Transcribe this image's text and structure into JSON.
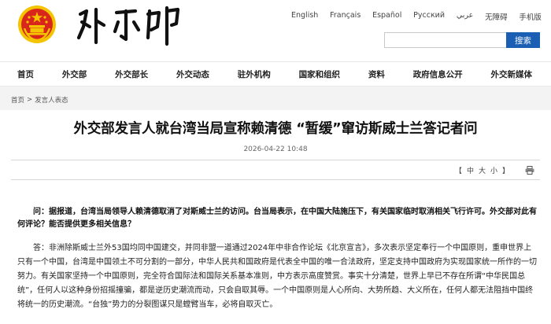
{
  "header": {
    "logo_alt": "国徽",
    "site_name": "外交部"
  },
  "languages": [
    "English",
    "Français",
    "Español",
    "Русский",
    "عربي",
    "无障碍",
    "手机版"
  ],
  "search": {
    "placeholder": "",
    "button_label": "搜索"
  },
  "nav": [
    "首页",
    "外交部",
    "外交部长",
    "外交动态",
    "驻外机构",
    "国家和组织",
    "资料",
    "政府信息公开",
    "外交新媒体"
  ],
  "breadcrumb": [
    "首页",
    "发言人表态"
  ],
  "breadcrumb_sep": ">",
  "article": {
    "title": "外交部发言人就台湾当局宣称赖清德 “暂缓”窜访斯威士兰答记者问",
    "date": "2026-04-22 10:48",
    "font_tools": {
      "open": "【",
      "large": "中",
      "medium": "大",
      "small": "小",
      "close": "】"
    },
    "print_label": "",
    "question": "问：据报道，台湾当局领导人赖清德取消了对斯威士兰的访问。台当局表示，在中国大陆施压下，有关国家临时取消相关飞行许可。外交部对此有何评论？能否提供更多相关信息？",
    "answer": "答：非洲除斯威士兰外53国均同中国建交，并同非盟一道通过2024年中非合作论坛《北京宣言》，多次表示坚定奉行一个中国原则，重申世界上只有一个中国，台湾是中国领土不可分割的一部分，中华人民共和国政府是代表全中国的唯一合法政府，坚定支持中国政府为实现国家统一所作的一切努力。有关国家坚持一个中国原则，完全符合国际法和国际关系基本准则，中方表示高度赞赏。事实十分清楚，世界上早已不存在所谓“中华民国总统”，任何人以这种身份招摇撞骗，都是逆历史潮流而动，只会自取其辱。一个中国原则是人心所向、大势所趋、大义所在，任何人都无法阻挡中国终将统一的历史潮流。“台独”势力的分裂图谋只是螳臂当车，必将自取灭亡。"
  },
  "colors": {
    "search_button": "#1a5fb4",
    "emblem_red": "#d8261c",
    "emblem_gold": "#f5c400"
  }
}
